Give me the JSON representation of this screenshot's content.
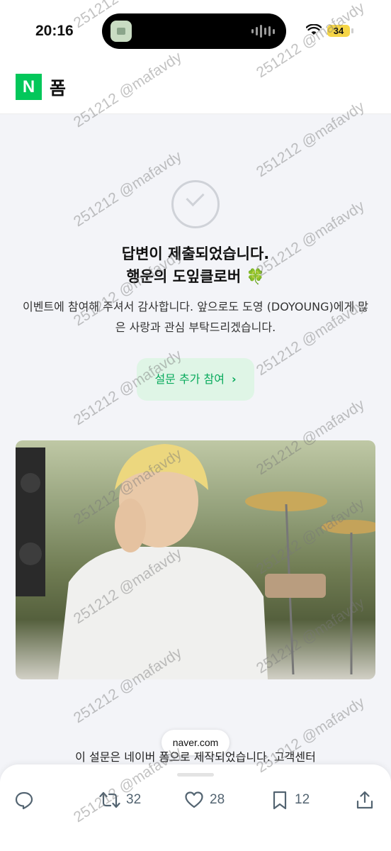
{
  "status_bar": {
    "time": "20:16",
    "battery": "34"
  },
  "header": {
    "logo_letter": "N",
    "title": "폼"
  },
  "confirmation": {
    "heading_line1": "답변이 제출되었습니다.",
    "heading_line2": "행운의 도잎클로버 🍀",
    "description": "이벤트에 참여해 주셔서 감사합니다. 앞으로도 도영 (DOYOUNG)에게 많은 사랑과 관심 부탁드리겠습니다.",
    "cta_label": "설문 추가 참여",
    "cta_chevron": "›"
  },
  "footer_text": "이 설문은 네이버 폼으로 제작되었습니다. 고객센터",
  "browser": {
    "url": "naver.com"
  },
  "tweet_actions": {
    "reply": "",
    "retweets": "32",
    "likes": "28",
    "bookmarks": "12"
  },
  "watermark": "251212 @mafavdy",
  "colors": {
    "naver_green": "#03c75a",
    "cta_bg": "#dff5e6",
    "cta_text": "#09aa5c",
    "battery": "#f5d547"
  }
}
